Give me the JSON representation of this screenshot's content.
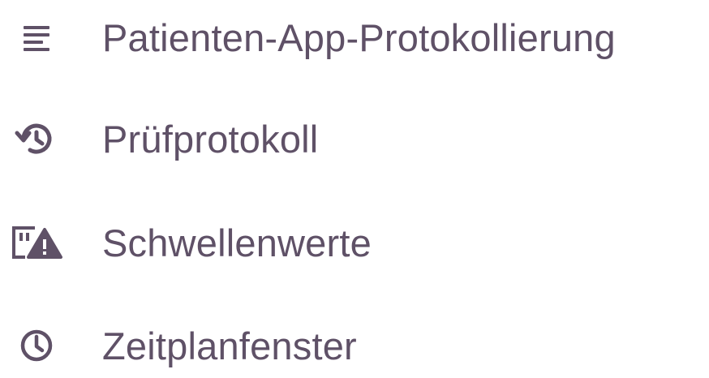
{
  "menu": {
    "items": [
      {
        "label": "Patienten-App-Protokollierung",
        "icon": "sort-lines-icon"
      },
      {
        "label": "Prüfprotokoll",
        "icon": "history-icon"
      },
      {
        "label": "Schwellenwerte",
        "icon": "threshold-warning-icon"
      },
      {
        "label": "Zeitplanfenster",
        "icon": "clock-icon"
      }
    ]
  },
  "colors": {
    "text": "#5f5167",
    "icon": "#5f5167",
    "background": "#ffffff"
  }
}
